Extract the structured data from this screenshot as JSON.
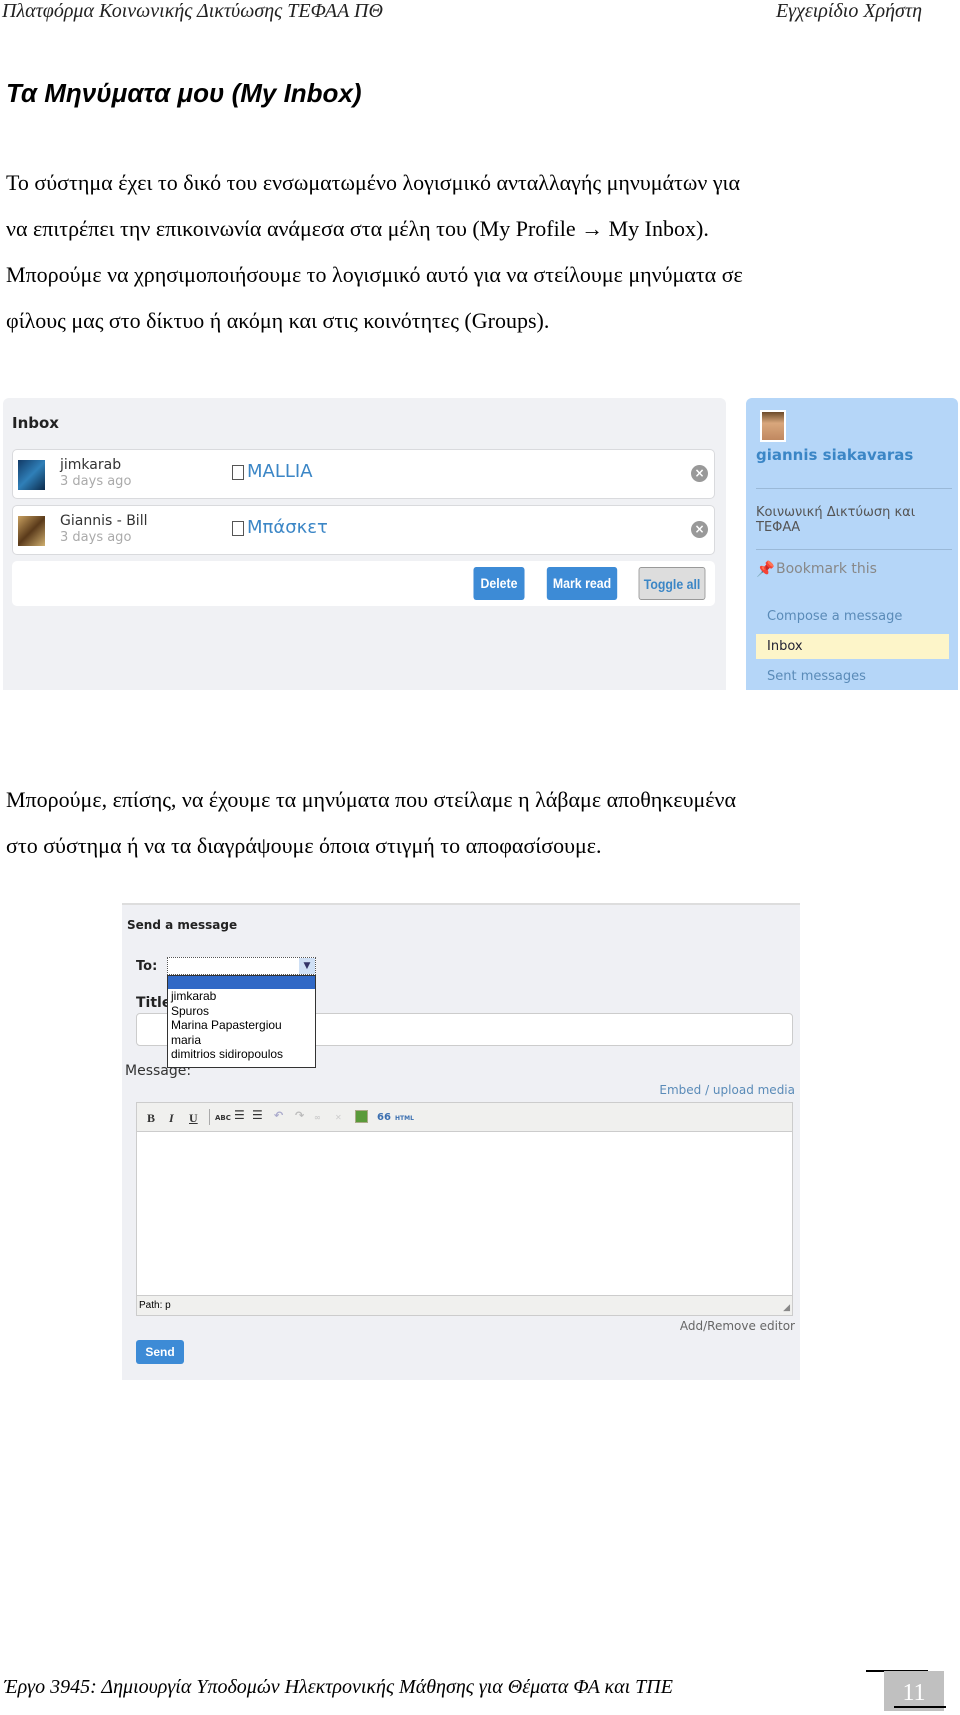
{
  "header": {
    "left": "Πλατφόρμα Κοινωνικής Δικτύωσης ΤΕΦΑΑ ΠΘ",
    "right": "Εγχειρίδιο Χρήστη"
  },
  "section_title": "Τα Μηνύματα μου (My Inbox)",
  "para1": [
    "Το σύστημα έχει το δικό του ενσωματωμένο λογισμικό ανταλλαγής μηνυμάτων για",
    "να επιτρέπει την επικοινωνία ανάμεσα στα μέλη του (My Profile",
    "My Inbox).",
    "Μπορούμε να χρησιμοποιήσουμε το λογισμικό αυτό για να στείλουμε μηνύματα σε",
    "φίλους μας στο δίκτυο ή ακόμη και στις κοινότητες (Groups)."
  ],
  "arrow": "→",
  "inbox": {
    "title": "Inbox",
    "messages": [
      {
        "sender": "jimkarab",
        "time": "3 days ago",
        "subject": "MALLIA"
      },
      {
        "sender": "Giannis - Bill",
        "time": "3 days ago",
        "subject": "Μπάσκετ"
      }
    ],
    "buttons": {
      "delete": "Delete",
      "mark_read": "Mark read",
      "toggle_all": "Toggle all"
    }
  },
  "sidebar": {
    "user": "giannis siakavaras",
    "group": [
      "Κοινωνική Δικτύωση και",
      "ΤΕΦΑΑ"
    ],
    "bookmark": "Bookmark this",
    "compose": "Compose a message",
    "inbox": "Inbox",
    "sent": "Sent messages"
  },
  "para2": [
    "Μπορούμε, επίσης, να έχουμε τα μηνύματα που στείλαμε η λάβαμε αποθηκευμένα",
    "στο σύστημα ή να τα διαγράψουμε όποια στιγμή το αποφασίσουμε."
  ],
  "send": {
    "title": "Send a message",
    "to_label": "To:",
    "to_options": [
      "",
      "jimkarab",
      "Spuros",
      "Marina Papastergiou",
      "maria",
      "dimitrios sidiropoulos"
    ],
    "title_label": "Title:",
    "message_label": "Message:",
    "embed": "Embed / upload media",
    "toolbar": {
      "bold": "B",
      "italic": "I",
      "underline": "U",
      "spell": "ABC",
      "quote": "66",
      "html": "HTML"
    },
    "path": "Path: p",
    "add_remove": "Add/Remove editor",
    "send_button": "Send"
  },
  "footer": {
    "text": "Έργο 3945: Δημιουργία Υποδομών Ηλεκτρονικής Μάθησης για Θέματα ΦΑ και ΤΠΕ",
    "page": "11"
  },
  "colors": {
    "button_blue": "#3d8bd6",
    "link_blue": "#3b86c6",
    "sidebar_bg": "#b5d6f8",
    "highlight": "#fdf5c9"
  }
}
